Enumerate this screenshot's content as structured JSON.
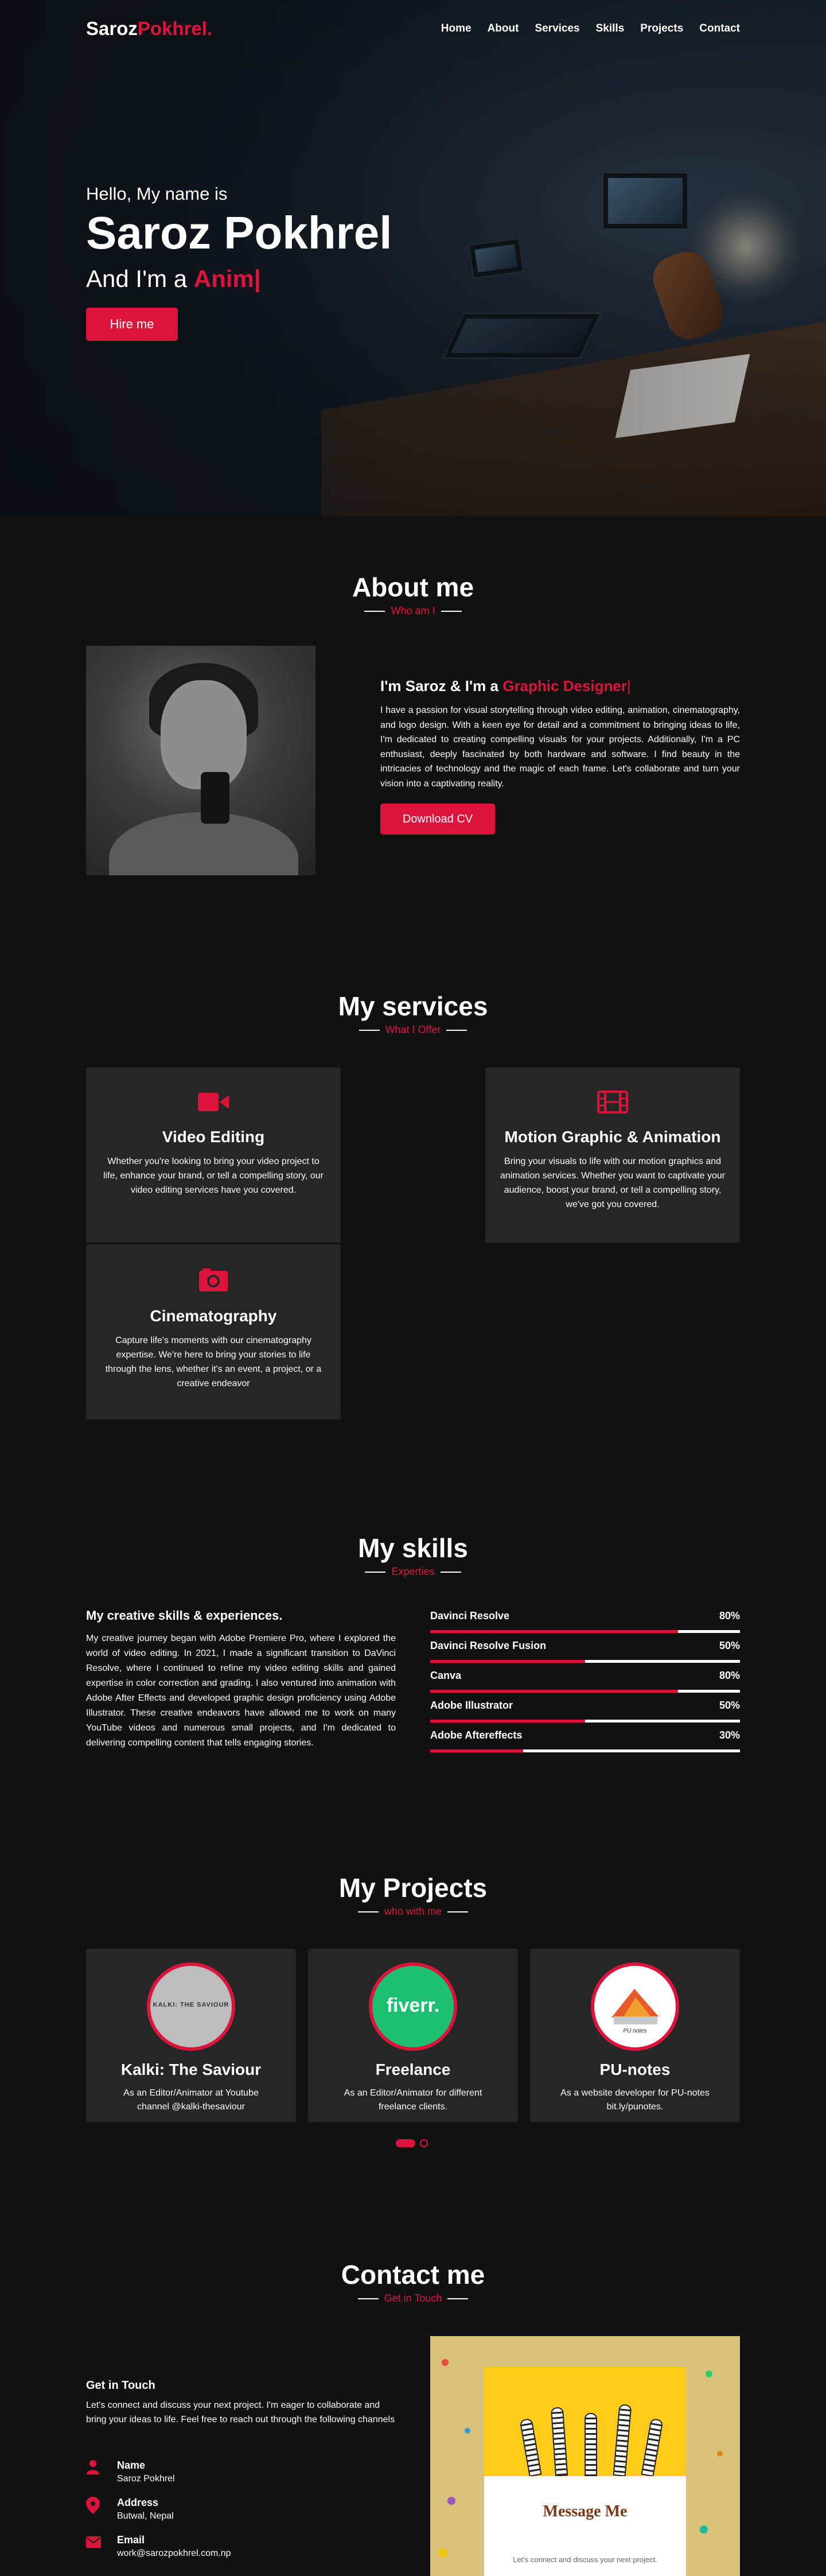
{
  "nav": {
    "logo_first": "Saroz",
    "logo_second": "Pokhrel.",
    "items": [
      {
        "label": "Home"
      },
      {
        "label": "About"
      },
      {
        "label": "Services"
      },
      {
        "label": "Skills"
      },
      {
        "label": "Projects"
      },
      {
        "label": "Contact"
      }
    ]
  },
  "hero": {
    "hello": "Hello, My name is",
    "name": "Saroz Pokhrel",
    "role_prefix": "And I'm a ",
    "role_typed": "Anim|",
    "hire_label": "Hire me"
  },
  "about": {
    "title": "About me",
    "subtitle": "Who am I",
    "heading_prefix": "I'm Saroz & I'm a ",
    "heading_accent": "Graphic Designer",
    "cursor": "|",
    "body": "I have a passion for visual storytelling through video editing, animation, cinematography, and logo design. With a keen eye for detail and a commitment to bringing ideas to life, I'm dedicated to creating compelling visuals for your projects. Additionally, I'm a PC enthusiast, deeply fascinated by both hardware and software. I find beauty in the intricacies of technology and the magic of each frame. Let's collaborate and turn your vision into a captivating reality.",
    "download_label": "Download CV"
  },
  "services": {
    "title": "My services",
    "subtitle": "What I Offer",
    "cards": [
      {
        "icon": "video-camera-icon",
        "title": "Video Editing",
        "text": "Whether you're looking to bring your video project to life, enhance your brand, or tell a compelling story, our video editing services have you covered."
      },
      {
        "icon": "film-icon",
        "title": "Motion Graphic & Animation",
        "text": "Bring your visuals to life with our motion graphics and animation services. Whether you want to captivate your audience, boost your brand, or tell a compelling story, we've got you covered."
      },
      {
        "icon": "camera-icon",
        "title": "Cinematography",
        "text": "Capture life's moments with our cinematography expertise. We're here to bring your stories to life through the lens, whether it's an event, a project, or a creative endeavor"
      }
    ]
  },
  "skills": {
    "title": "My skills",
    "subtitle": "Experties",
    "heading": "My creative skills & experiences.",
    "body": "My creative journey began with Adobe Premiere Pro, where I explored the world of video editing. In 2021, I made a significant transition to DaVinci Resolve, where I continued to refine my video editing skills and gained expertise in color correction and grading. I also ventured into animation with Adobe After Effects and developed graphic design proficiency using Adobe Illustrator. These creative endeavors have allowed me to work on many YouTube videos and numerous small projects, and I'm dedicated to delivering compelling content that tells engaging stories.",
    "items": [
      {
        "name": "Davinci Resolve",
        "percent_label": "80%",
        "level": 0.8
      },
      {
        "name": "Davinci Resolve Fusion",
        "percent_label": "50%",
        "level": 0.5
      },
      {
        "name": "Canva",
        "percent_label": "80%",
        "level": 0.8
      },
      {
        "name": "Adobe Illustrator",
        "percent_label": "50%",
        "level": 0.5
      },
      {
        "name": "Adobe Aftereffects",
        "percent_label": "30%",
        "level": 0.3
      }
    ]
  },
  "projects": {
    "title": "My Projects",
    "subtitle": "who with me",
    "items": [
      {
        "logo_text": "KALKI: THE SAVIOUR",
        "title": "Kalki: The Saviour",
        "text": "As an Editor/Animator at Youtube channel @kalki-thesaviour"
      },
      {
        "logo_text": "fiverr.",
        "title": "Freelance",
        "text": "As an Editor/Animator for different freelance clients."
      },
      {
        "logo_text": "PU notes",
        "title": "PU-notes",
        "text": "As a website developer for PU-notes bit.ly/punotes."
      }
    ]
  },
  "contact": {
    "title": "Contact me",
    "subtitle": "Get in Touch",
    "heading": "Get in Touch",
    "body": "Let's connect and discuss your next project. I'm eager to collaborate and bring your ideas to life. Feel free to reach out through the following channels",
    "info": [
      {
        "icon": "user-icon",
        "label": "Name",
        "value": "Saroz Pokhrel"
      },
      {
        "icon": "location-pin-icon",
        "label": "Address",
        "value": "Butwal, Nepal"
      },
      {
        "icon": "envelope-icon",
        "label": "Email",
        "value": "work@sarozpokhrel.com.np"
      }
    ],
    "card_title": "Message Me",
    "card_text": "Let's connect and discuss your next project."
  },
  "colors": {
    "accent": "#dc143c",
    "background": "#111111",
    "card": "#262626"
  }
}
